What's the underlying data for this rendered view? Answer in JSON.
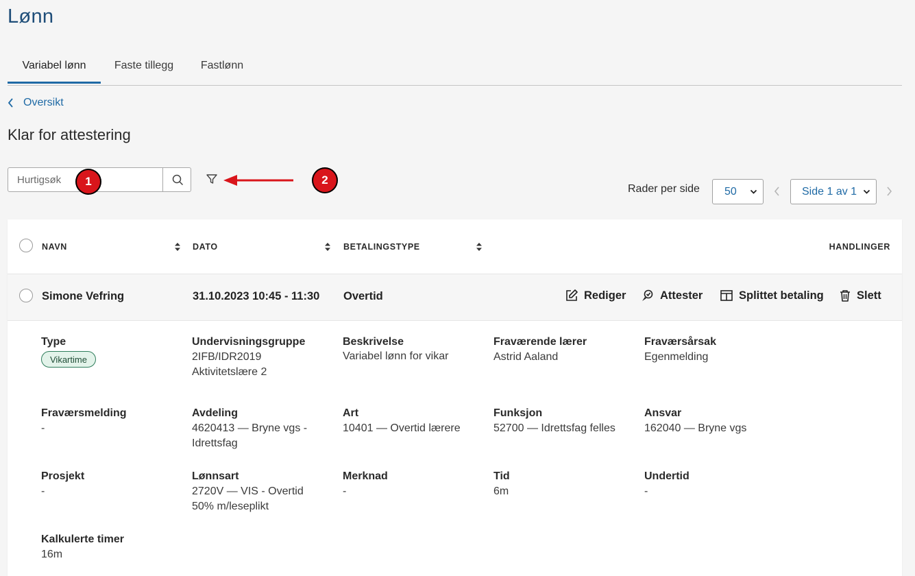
{
  "page": {
    "title": "Lønn"
  },
  "tabs": [
    "Variabel lønn",
    "Faste tillegg",
    "Fastlønn"
  ],
  "breadcrumb": {
    "back_label": "Oversikt"
  },
  "section": {
    "title": "Klar for attestering"
  },
  "search": {
    "placeholder": "Hurtigsøk"
  },
  "annotations": [
    "1",
    "2"
  ],
  "pagination": {
    "rows_label": "Rader per side",
    "rows_value": "50",
    "page_value": "Side 1 av 1"
  },
  "table": {
    "headers": {
      "name": "NAVN",
      "date": "DATO",
      "payment_type": "BETALINGSTYPE",
      "actions": "HANDLINGER"
    },
    "row": {
      "name": "Simone Vefring",
      "date": "31.10.2023 10:45 - 11:30",
      "payment_type": "Overtid",
      "actions": {
        "edit": "Rediger",
        "attest": "Attester",
        "split": "Splittet betaling",
        "delete": "Slett"
      }
    }
  },
  "details": [
    {
      "label": "Type",
      "value": "Vikartime"
    },
    {
      "label": "Undervisningsgruppe",
      "value": "2IFB/IDR2019\nAktivitetslære 2"
    },
    {
      "label": "Beskrivelse",
      "value": "Variabel lønn for vikar"
    },
    {
      "label": "Fraværende lærer",
      "value": "Astrid Aaland"
    },
    {
      "label": "Fraværsårsak",
      "value": "Egenmelding"
    },
    {
      "label": "Fraværsmelding",
      "value": "-"
    },
    {
      "label": "Avdeling",
      "value": "4620413 — Bryne vgs -\nIdrettsfag"
    },
    {
      "label": "Art",
      "value": "10401 — Overtid lærere"
    },
    {
      "label": "Funksjon",
      "value": "52700 — Idrettsfag felles"
    },
    {
      "label": "Ansvar",
      "value": "162040 — Bryne vgs"
    },
    {
      "label": "Prosjekt",
      "value": "-"
    },
    {
      "label": "Lønnsart",
      "value": "2720V — VIS - Overtid\n50% m/leseplikt"
    },
    {
      "label": "Merknad",
      "value": "-"
    },
    {
      "label": "Tid",
      "value": "6m"
    },
    {
      "label": "Undertid",
      "value": "-"
    },
    {
      "label": "Kalkulerte timer",
      "value": "16m"
    }
  ],
  "colors": {
    "brand_blue": "#1f4e79",
    "link_blue": "#1f6aa5",
    "annotation_red": "#d9151b",
    "chip_green": "#2e7d5b"
  }
}
